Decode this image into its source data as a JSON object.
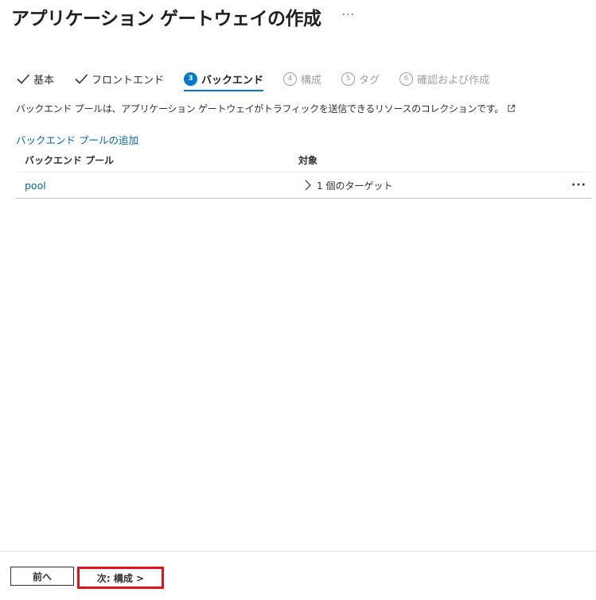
{
  "page": {
    "title": "アプリケーション ゲートウェイの作成",
    "more": "···"
  },
  "steps": [
    {
      "label": "基本",
      "state": "done"
    },
    {
      "label": "フロントエンド",
      "state": "done"
    },
    {
      "number": "3",
      "label": "バックエンド",
      "state": "active"
    },
    {
      "number": "4",
      "label": "構成",
      "state": "pending"
    },
    {
      "number": "5",
      "label": "タグ",
      "state": "pending"
    },
    {
      "number": "6",
      "label": "確認および作成",
      "state": "pending"
    }
  ],
  "description": "バックエンド プールは、アプリケーション ゲートウェイがトラフィックを送信できるリソースのコレクションです。",
  "add_link": "バックエンド プールの追加",
  "table": {
    "headers": [
      "バックエンド プール",
      "対象"
    ],
    "rows": [
      {
        "pool": "pool",
        "target": "1 個のターゲット",
        "more": "···"
      }
    ]
  },
  "footer": {
    "prev_label": "前へ",
    "next_label": "次: 構成 >"
  },
  "colors": {
    "accent": "#0078d4",
    "link": "#0067b8",
    "highlight": "#e5101a"
  }
}
